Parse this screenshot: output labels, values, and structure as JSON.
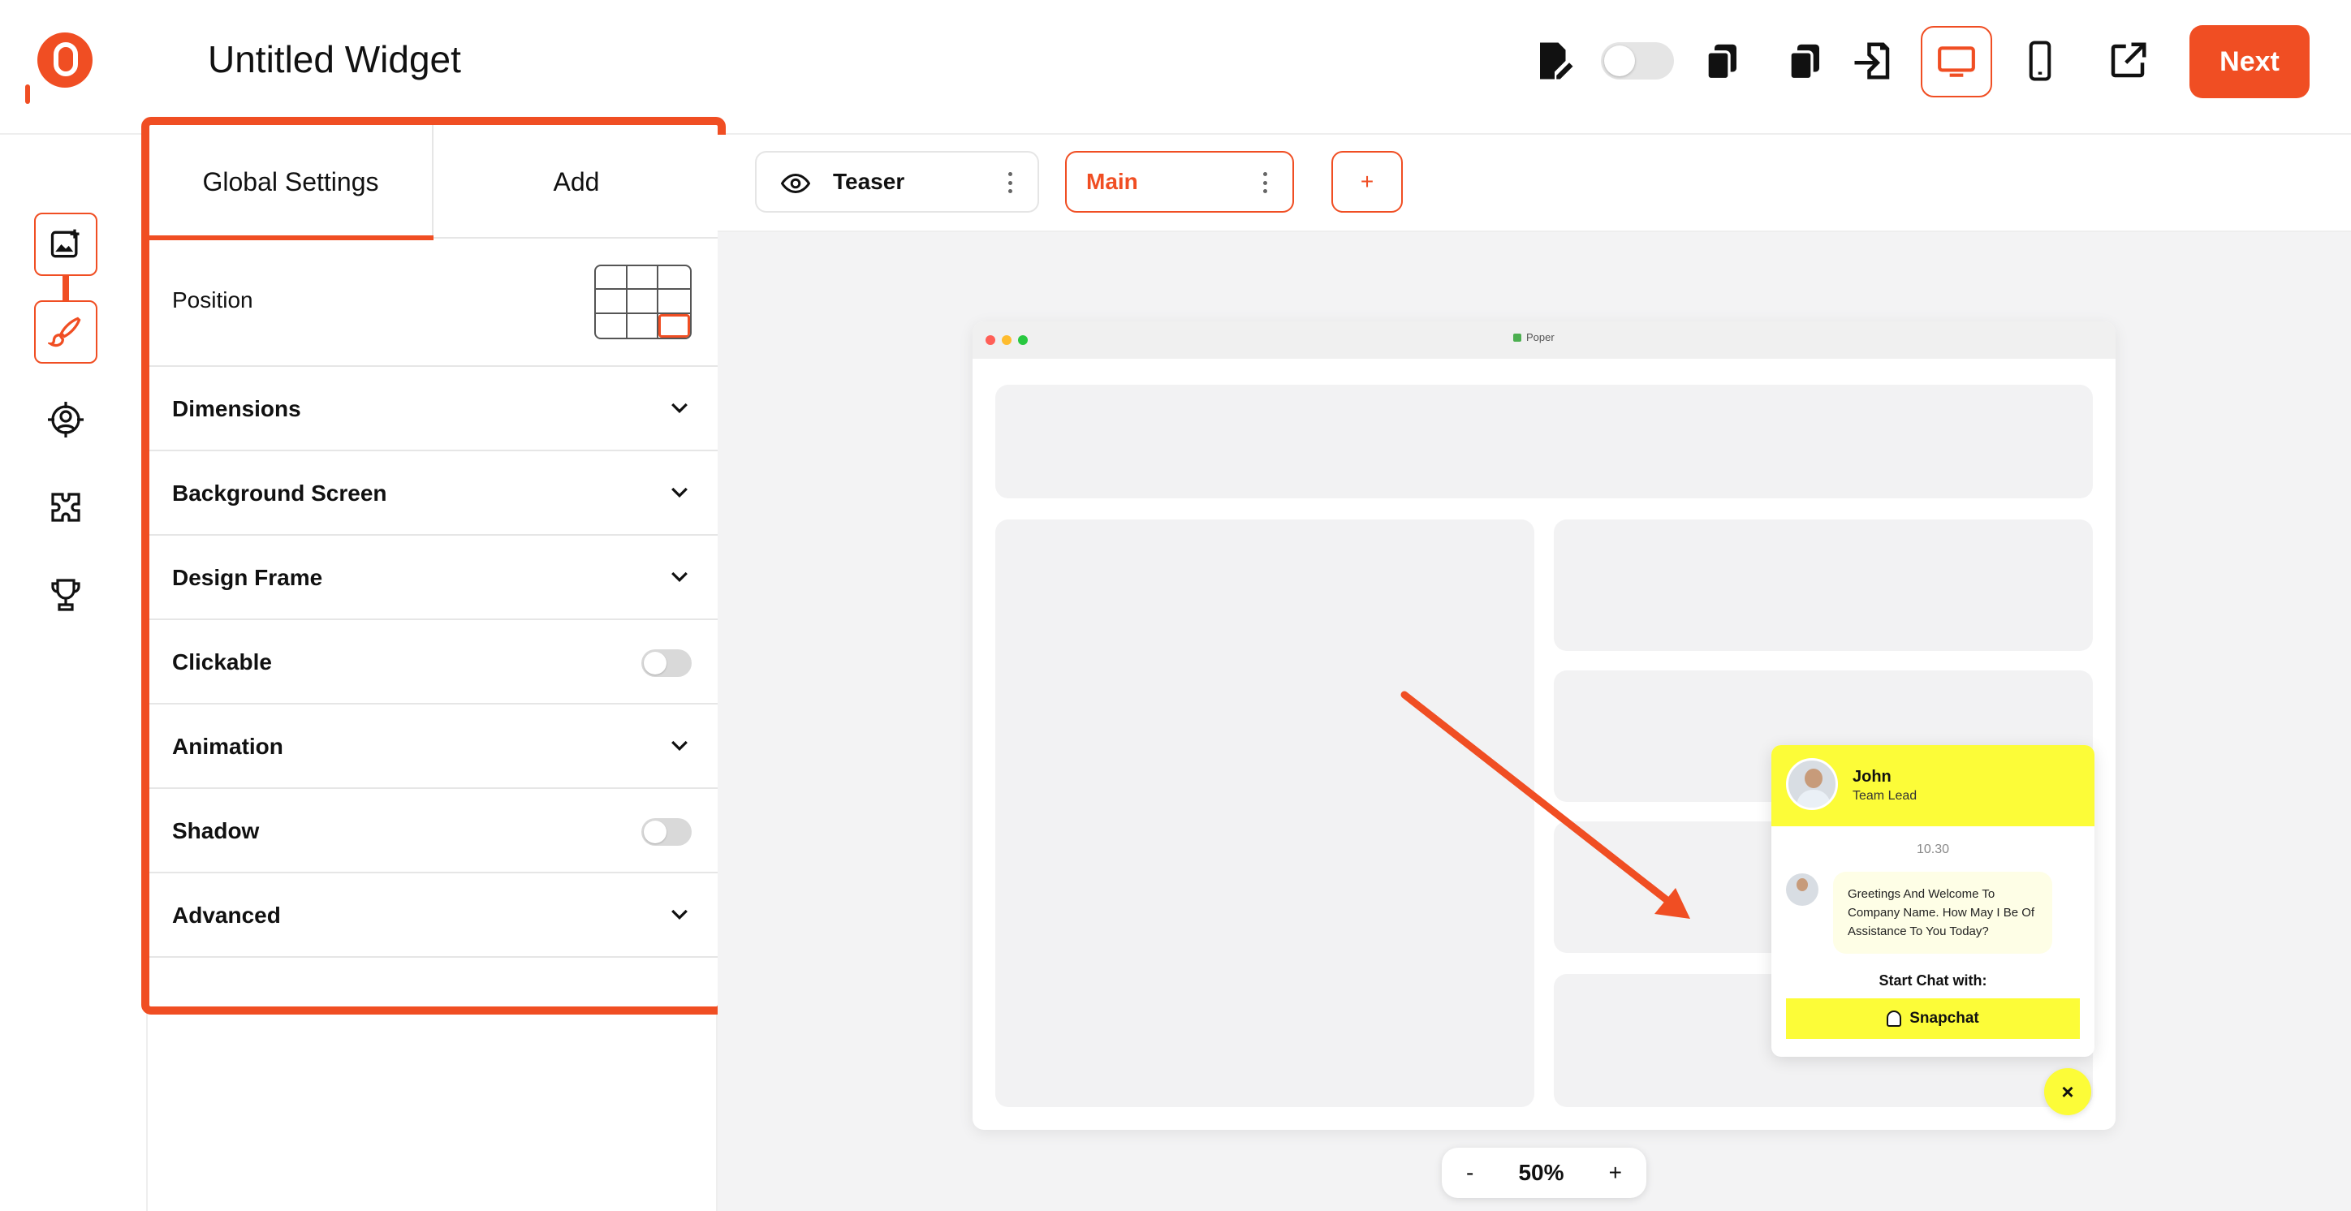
{
  "header": {
    "title": "Untitled Widget",
    "next_label": "Next"
  },
  "panel": {
    "tabs": [
      "Global Settings",
      "Add"
    ],
    "position_label": "Position",
    "sections": {
      "dimensions": "Dimensions",
      "background_screen": "Background Screen",
      "design_frame": "Design Frame",
      "clickable": "Clickable",
      "animation": "Animation",
      "shadow": "Shadow",
      "advanced": "Advanced"
    },
    "clickable_on": false,
    "shadow_on": false
  },
  "screens": {
    "teaser_label": "Teaser",
    "main_label": "Main",
    "add_label": "+"
  },
  "browser": {
    "site_label": "Poper"
  },
  "chat": {
    "name": "John",
    "role": "Team Lead",
    "time": "10.30",
    "message": "Greetings And Welcome To Company Name. How May I Be Of Assistance To You Today?",
    "start_label": "Start Chat with:",
    "button_label": "Snapchat",
    "close_label": "×"
  },
  "zoom": {
    "minus": "-",
    "value": "50%",
    "plus": "+"
  },
  "colors": {
    "accent": "#f04e23",
    "widget_yellow": "#fcfc38"
  }
}
